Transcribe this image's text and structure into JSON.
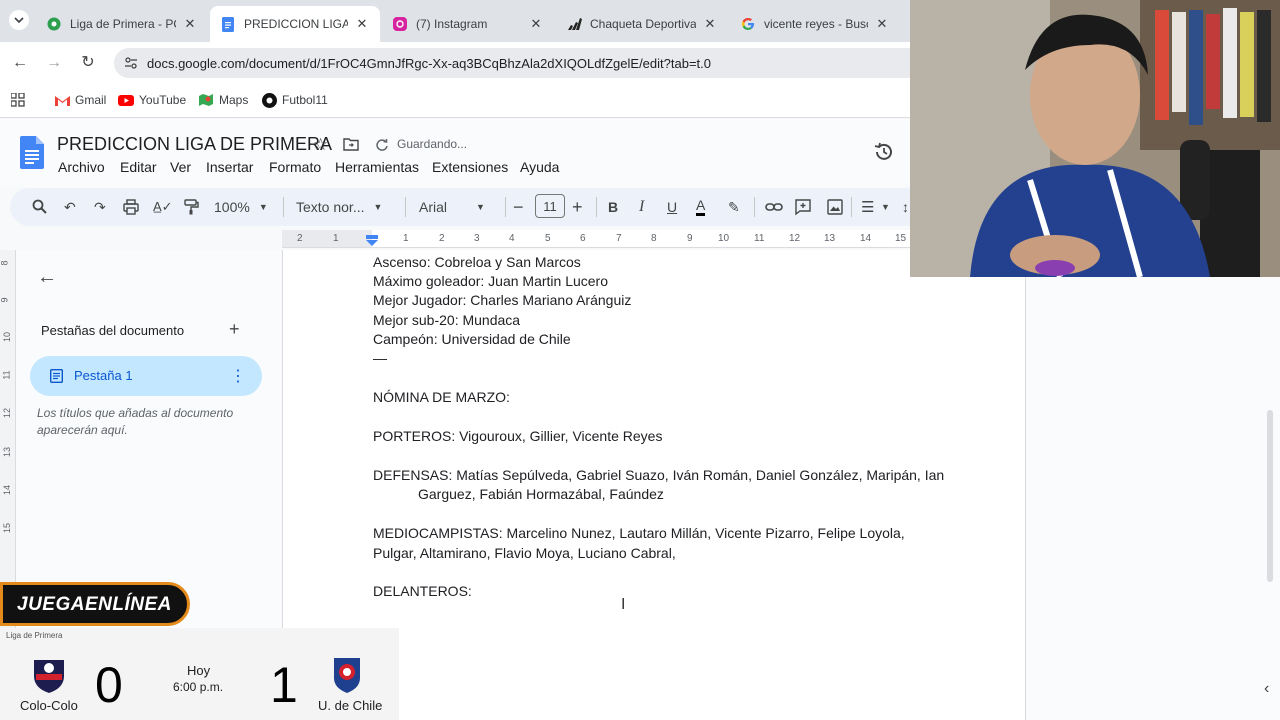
{
  "browser": {
    "tabs": [
      {
        "title": "Liga de Primera - POS",
        "icon": "soccer-ball-icon",
        "active": false
      },
      {
        "title": "PREDICCION LIGA DE",
        "icon": "docs-icon",
        "active": true
      },
      {
        "title": "(7) Instagram",
        "icon": "instagram-icon",
        "active": false
      },
      {
        "title": "Chaqueta Deportiva l",
        "icon": "adidas-icon",
        "active": false
      },
      {
        "title": "vicente reyes - Buscar",
        "icon": "google-icon",
        "active": false
      }
    ],
    "url": "docs.google.com/document/d/1FrOC4GmnJfRgc-Xx-aq3BCqBhzAla2dXIQOLdfZgelE/edit?tab=t.0",
    "bookmarks": [
      {
        "label": "Gmail",
        "icon": "gmail-icon"
      },
      {
        "label": "YouTube",
        "icon": "youtube-icon"
      },
      {
        "label": "Maps",
        "icon": "maps-icon"
      },
      {
        "label": "Futbol11",
        "icon": "futbol11-icon"
      }
    ]
  },
  "docs": {
    "title": "PREDICCION LIGA DE PRIMERA",
    "status": "Guardando...",
    "menus": [
      "Archivo",
      "Editar",
      "Ver",
      "Insertar",
      "Formato",
      "Herramientas",
      "Extensiones",
      "Ayuda"
    ],
    "toolbar": {
      "zoom": "100%",
      "style": "Texto nor...",
      "font": "Arial",
      "font_size": "11"
    },
    "ruler_numbers": [
      "2",
      "1",
      "1",
      "2",
      "3",
      "4",
      "5",
      "6",
      "7",
      "8",
      "9",
      "10",
      "11",
      "12",
      "13",
      "14",
      "15"
    ],
    "vruler_numbers": [
      "8",
      "9",
      "10",
      "11",
      "12",
      "13",
      "14",
      "15"
    ],
    "sidebar": {
      "heading": "Pestañas del documento",
      "tab_label": "Pestaña 1",
      "hint": "Los títulos que añadas al documento aparecerán aquí."
    },
    "content": [
      "Ascenso: Cobreloa y San Marcos",
      "Máximo goleador: Juan Martin Lucero",
      "Mejor Jugador: Charles Mariano Aránguiz",
      "Mejor sub-20: Mundaca",
      "Campeón: Universidad de Chile",
      "—",
      "NÓMINA DE MARZO:",
      "PORTEROS: Vigouroux, Gillier, Vicente Reyes",
      "DEFENSAS: Matías Sepúlveda, Gabriel Suazo, Iván Román, Daniel González, Maripán, Ian",
      "Garguez, Fabián Hormazábal, Faúndez",
      "MEDIOCAMPISTAS: Marcelino Nunez, Lautaro Millán, Vicente Pizarro, Felipe Loyola,",
      "Pulgar, Altamirano, Flavio Moya, Luciano Cabral,",
      "DELANTEROS:"
    ]
  },
  "overlay": {
    "brand": "JUEGAENLÍNEA",
    "league": "Liga de Primera",
    "home_team": "Colo-Colo",
    "home_score": "0",
    "match_day": "Hoy",
    "match_time": "6:00 p.m.",
    "away_score": "1",
    "away_team": "U. de Chile"
  },
  "colors": {
    "docs_blue": "#4285f4",
    "tab_active_bg": "#c2e7ff",
    "brand_orange": "#e38a1a"
  }
}
